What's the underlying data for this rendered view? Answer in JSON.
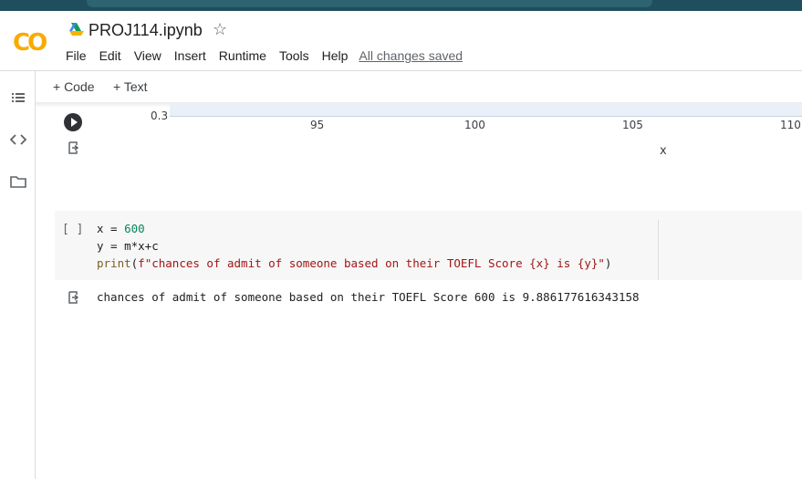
{
  "notebook": {
    "title": "PROJ114.ipynb",
    "logo_text": "CO",
    "menu": [
      "File",
      "Edit",
      "View",
      "Insert",
      "Runtime",
      "Tools",
      "Help"
    ],
    "saved_status": "All changes saved"
  },
  "toolbar": {
    "add_code": "+ Code",
    "add_text": "+ Text"
  },
  "plot_fragment": {
    "y_tick": "0.3",
    "x_ticks": [
      "95",
      "100",
      "105",
      "110"
    ],
    "x_label": "x"
  },
  "cell": {
    "exec_count": "[ ]",
    "lines": [
      {
        "a": "x = ",
        "b": "600",
        "c": ""
      },
      {
        "a": "y = m*x+c",
        "b": "",
        "c": ""
      }
    ],
    "print_fn": "print",
    "print_open": "(",
    "print_string": "f\"chances of admit of someone based on their TOEFL Score {x} is {y}\"",
    "print_close": ")",
    "output": "chances of admit of someone based on their TOEFL Score 600 is 9.886177616343158"
  },
  "icons": {
    "rail": [
      "toc-icon",
      "code-snippets-icon",
      "files-icon"
    ],
    "accent": "#f9ab00"
  }
}
